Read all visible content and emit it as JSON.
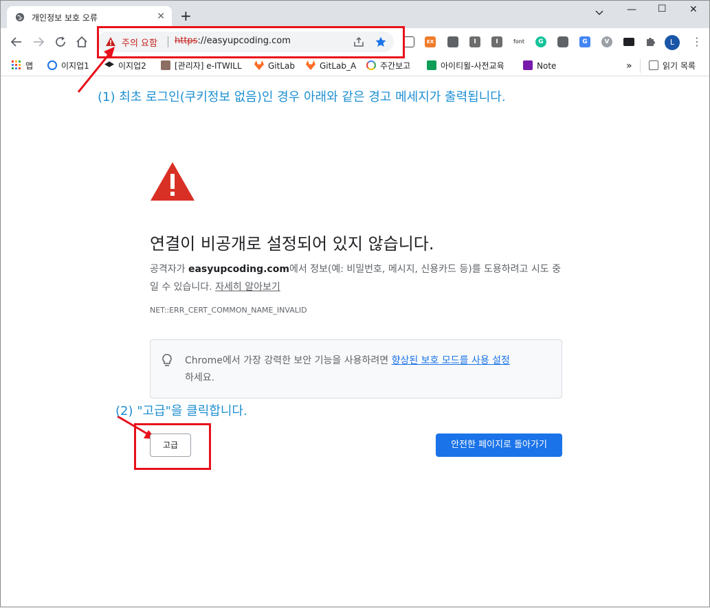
{
  "tab": {
    "title": "개인정보 보호 오류",
    "close": "✕"
  },
  "window": {
    "new_tab": "+",
    "minimize": "—",
    "maximize": "☐",
    "close": "✕"
  },
  "omnibox": {
    "warning": "주의 요함",
    "url_scheme": "https",
    "url_rest": "://easyupcoding.com"
  },
  "profile_initial": "L",
  "bookmarks": {
    "items": [
      {
        "label": "앱",
        "icon": "apps-grid-icon"
      },
      {
        "label": "이지업1",
        "icon": "eizup-icon"
      },
      {
        "label": "이지업2",
        "icon": "graduation-cap-icon"
      },
      {
        "label": "[관리자] e-ITWILL",
        "icon": "sys-icon"
      },
      {
        "label": "GitLab",
        "icon": "gitlab-icon"
      },
      {
        "label": "GitLab_A",
        "icon": "gitlab-icon"
      },
      {
        "label": "주간보고",
        "icon": "google-icon"
      },
      {
        "label": "아이티윌-사전교육",
        "icon": "sheets-icon"
      },
      {
        "label": "Note",
        "icon": "onenote-icon"
      }
    ],
    "overflow": "»",
    "reading_list": "읽기 목록"
  },
  "extensions": {
    "font_label": "font",
    "ex_label": "EX"
  },
  "annotations": {
    "step1": "(1) 최초 로그인(쿠키정보 없음)인 경우 아래와 같은 경고 메세지가 출력됩니다.",
    "step2": "(2) \"고급\"을 클릭합니다."
  },
  "interstitial": {
    "heading": "연결이 비공개로 설정되어 있지 않습니다.",
    "desc_prefix": "공격자가 ",
    "desc_domain": "easyupcoding.com",
    "desc_suffix": "에서 정보(예: 비밀번호, 메시지, 신용카드 등)를 도용하려고 시도 중일 수 있습니다. ",
    "learn_more": "자세히 알아보기",
    "error_code": "NET::ERR_CERT_COMMON_NAME_INVALID",
    "tip_prefix": "Chrome에서 가장 강력한 보안 기능을 사용하려면 ",
    "tip_link": "향상된 보호 모드를 사용 설정",
    "tip_suffix": "하세요.",
    "advanced_button": "고급",
    "back_button": "안전한 페이지로 돌아가기"
  },
  "colors": {
    "warning_red": "#c5221f",
    "annotation_red": "#e8101a",
    "annotation_blue": "#1d8fd1",
    "primary_blue": "#1a73e8"
  }
}
